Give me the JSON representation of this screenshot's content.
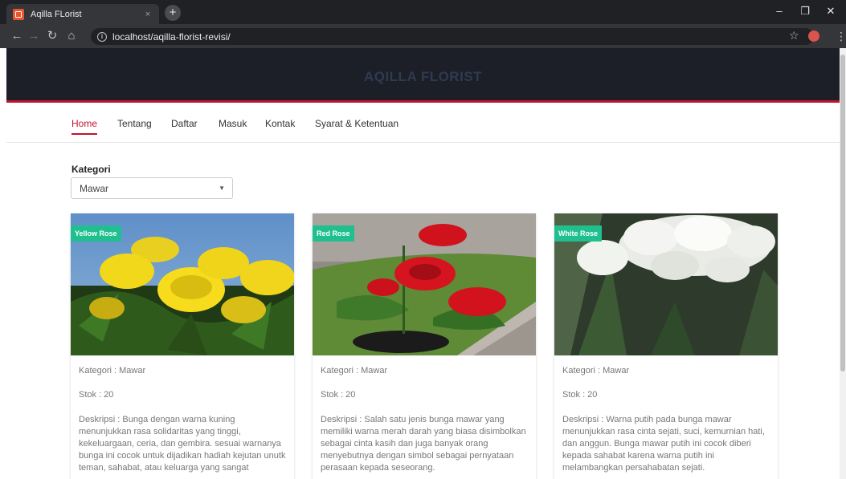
{
  "browser": {
    "tab_title": "Aqilla FLorist",
    "tab_close": "×",
    "new_tab": "+",
    "url": "localhost/aqilla-florist-revisi/",
    "window_controls": {
      "minimize": "–",
      "maximize": "❐",
      "close": "✕"
    },
    "icons": [
      "back-icon",
      "forward-icon",
      "reload-icon",
      "home-icon",
      "info-icon",
      "star-icon",
      "extension-icon",
      "menu-icon"
    ]
  },
  "site": {
    "brand": "AQILLA FLORIST",
    "nav": [
      {
        "label": "Home",
        "active": true
      },
      {
        "label": "Tentang",
        "active": false
      },
      {
        "label": "Daftar",
        "active": false
      },
      {
        "label": "Masuk",
        "active": false
      },
      {
        "label": "Kontak",
        "active": false
      },
      {
        "label": "Syarat & Ketentuan",
        "active": false
      }
    ],
    "filter": {
      "label": "Kategori",
      "selected": "Mawar"
    },
    "products": [
      {
        "badge": "Yellow Rose",
        "kategori": "Kategori : Mawar",
        "stok": "Stok : 20",
        "deskripsi": "Deskripsi : Bunga dengan warna kuning menunjukkan rasa solidaritas yang tinggi, kekeluargaan, ceria, dan gembira. sesuai warnanya bunga ini cocok untuk dijadikan hadiah kejutan unutk teman, sahabat, atau keluarga yang sangat"
      },
      {
        "badge": "Red Rose",
        "kategori": "Kategori : Mawar",
        "stok": "Stok : 20",
        "deskripsi": "Deskripsi : Salah satu jenis bunga mawar yang memiliki warna merah darah yang biasa disimbolkan sebagai cinta kasih dan juga banyak orang menyebutnya dengan simbol sebagai pernyataan perasaan kepada seseorang."
      },
      {
        "badge": "White Rose",
        "kategori": "Kategori : Mawar",
        "stok": "Stok : 20",
        "deskripsi": "Deskripsi : Warna putih pada bunga mawar menunjukkan rasa cinta sejati, suci, kemurnian hati, dan anggun. Bunga mawar putih ini cocok diberi kepada sahabat karena warna putih ini melambangkan persahabatan sejati."
      }
    ]
  },
  "colors": {
    "accent": "#c0152f",
    "badge": "#1fbf8f",
    "hero_bg": "#1c1f27",
    "brand_text": "#2f3b52"
  }
}
